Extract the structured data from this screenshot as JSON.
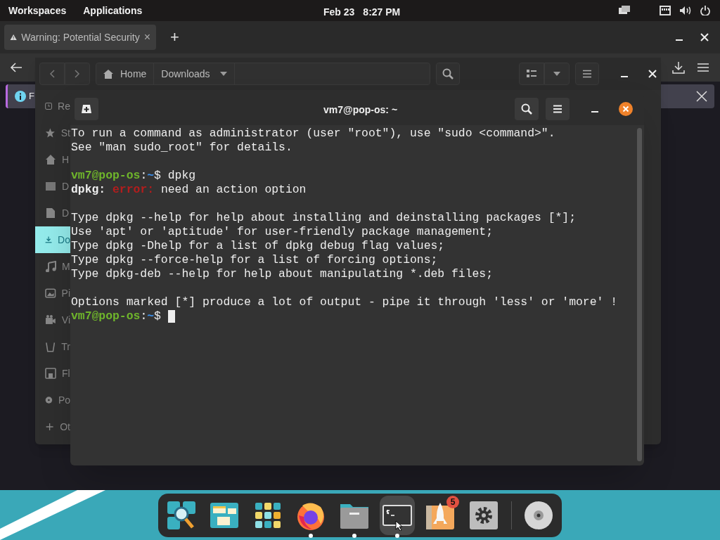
{
  "top_bar": {
    "workspaces": "Workspaces",
    "applications": "Applications",
    "date": "Feb 23",
    "time": "8:27 PM"
  },
  "browser": {
    "tab_title": "Warning: Potential Security",
    "tab_close": "×",
    "new_tab": "+",
    "info_text": "F"
  },
  "files": {
    "breadcrumbs": [
      {
        "label": "Home",
        "kind": "home"
      },
      {
        "label": "Downloads",
        "kind": "current"
      }
    ],
    "sidebar": [
      {
        "label": "Re",
        "kind": "clock",
        "selected": false
      },
      {
        "label": "St",
        "kind": "star",
        "selected": false
      },
      {
        "label": "H",
        "kind": "home",
        "selected": false
      },
      {
        "label": "D",
        "kind": "desktop",
        "selected": false
      },
      {
        "label": "D",
        "kind": "document",
        "selected": false
      },
      {
        "label": "Do",
        "kind": "download",
        "selected": true
      },
      {
        "label": "M",
        "kind": "music",
        "selected": false
      },
      {
        "label": "Pi",
        "kind": "image",
        "selected": false
      },
      {
        "label": "Vi",
        "kind": "video",
        "selected": false
      },
      {
        "label": "Tr",
        "kind": "trash",
        "selected": false
      },
      {
        "label": "Fl",
        "kind": "floppy",
        "selected": false
      },
      {
        "label": "Po",
        "kind": "disc",
        "selected": false
      },
      {
        "label": "Ot",
        "kind": "plus",
        "selected": false
      }
    ]
  },
  "terminal": {
    "title": "vm7@pop-os: ~",
    "blocks": [
      [
        [
          {
            "kind": "plain",
            "text": "To run a command as administrator (user \"root\"), use \"sudo <command>\"."
          }
        ],
        [
          {
            "kind": "plain",
            "text": "See \"man sudo_root\" for details."
          }
        ]
      ],
      [
        [
          {
            "kind": "user",
            "text": "vm7@pop-os"
          },
          {
            "kind": "plain",
            "text": ":"
          },
          {
            "kind": "path",
            "text": "~"
          },
          {
            "kind": "plain",
            "text": "$ dpkg"
          }
        ],
        [
          {
            "kind": "bold",
            "text": "dpkg: "
          },
          {
            "kind": "error",
            "text": "error:"
          },
          {
            "kind": "plain",
            "text": " need an action option"
          }
        ]
      ],
      [
        [
          {
            "kind": "plain",
            "text": "Type dpkg --help for help about installing and deinstalling packages [*];"
          }
        ],
        [
          {
            "kind": "plain",
            "text": "Use 'apt' or 'aptitude' for user-friendly package management;"
          }
        ],
        [
          {
            "kind": "plain",
            "text": "Type dpkg -Dhelp for a list of dpkg debug flag values;"
          }
        ],
        [
          {
            "kind": "plain",
            "text": "Type dpkg --force-help for a list of forcing options;"
          }
        ],
        [
          {
            "kind": "plain",
            "text": "Type dpkg-deb --help for help about manipulating *.deb files;"
          }
        ]
      ],
      [
        [
          {
            "kind": "plain",
            "text": "Options marked [*] produce a lot of output - pipe it through 'less' or 'more' !"
          }
        ],
        [
          {
            "kind": "user",
            "text": "vm7@pop-os"
          },
          {
            "kind": "plain",
            "text": ":"
          },
          {
            "kind": "path",
            "text": "~"
          },
          {
            "kind": "plain",
            "text": "$ "
          }
        ]
      ]
    ]
  },
  "dock": {
    "items": [
      {
        "kind": "search",
        "running": false,
        "selected": false
      },
      {
        "kind": "windows",
        "running": false,
        "selected": false
      },
      {
        "kind": "grid",
        "running": false,
        "selected": false
      },
      {
        "kind": "firefox",
        "running": true,
        "selected": false
      },
      {
        "kind": "files",
        "running": true,
        "selected": false
      },
      {
        "kind": "terminal",
        "running": true,
        "selected": true
      },
      {
        "kind": "store",
        "running": false,
        "selected": false,
        "badge": "5"
      },
      {
        "kind": "settings",
        "running": false,
        "selected": false
      },
      {
        "kind": "disc",
        "running": false,
        "selected": false
      }
    ]
  }
}
